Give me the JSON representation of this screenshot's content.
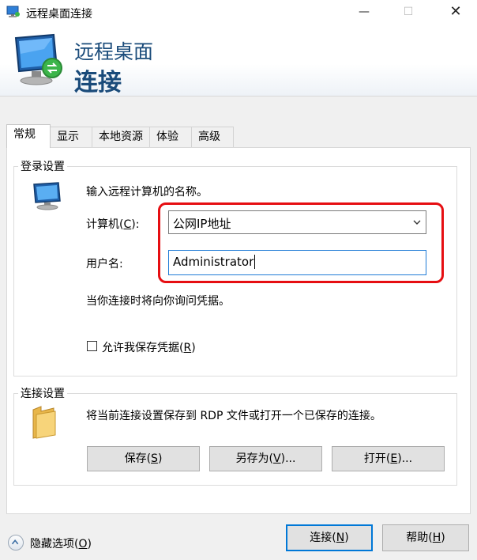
{
  "window": {
    "title": "远程桌面连接",
    "minimize_glyph": "—",
    "maximize_glyph": "☐",
    "close_glyph": "✕"
  },
  "banner": {
    "line1": "远程桌面",
    "line2": "连接"
  },
  "tabs": [
    {
      "label": "常规",
      "active": true
    },
    {
      "label": "显示"
    },
    {
      "label": "本地资源"
    },
    {
      "label": "体验"
    },
    {
      "label": "高级"
    }
  ],
  "login": {
    "group_label": "登录设置",
    "instruction": "输入远程计算机的名称。",
    "computer_label": "计算机(",
    "computer_key": "C",
    "computer_label_end": "):",
    "computer_value": "公网IP地址",
    "username_label": "用户名:",
    "username_value": "Administrator",
    "prompt_note": "当你连接时将向你询问凭据。",
    "save_cred_label": "允许我保存凭据(",
    "save_cred_key": "R",
    "save_cred_end": ")",
    "save_cred_checked": false
  },
  "connection": {
    "group_label": "连接设置",
    "description": "将当前连接设置保存到 RDP 文件或打开一个已保存的连接。",
    "save": {
      "label": "保存(",
      "key": "S",
      "end": ")"
    },
    "save_as": {
      "label": "另存为(",
      "key": "V",
      "end": ")..."
    },
    "open": {
      "label": "打开(",
      "key": "E",
      "end": ")..."
    }
  },
  "footer": {
    "hide_options": {
      "label": "隐藏选项(",
      "key": "O",
      "end": ")"
    },
    "connect": {
      "label": "连接(",
      "key": "N",
      "end": ")"
    },
    "help": {
      "label": "帮助(",
      "key": "H",
      "end": ")"
    }
  },
  "colors": {
    "highlight": "#e60e12",
    "accent": "#0078d7",
    "banner_text": "#1a4b7a"
  }
}
